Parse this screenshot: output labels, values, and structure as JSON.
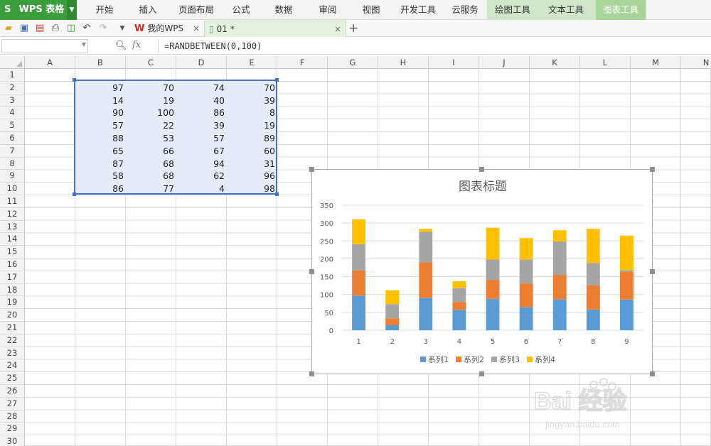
{
  "app": {
    "name": "WPS 表格",
    "logo_letter": "S"
  },
  "menu": {
    "items": [
      "开始",
      "插入",
      "页面布局",
      "公式",
      "数据",
      "审阅",
      "视图",
      "开发工具",
      "云服务",
      "绘图工具",
      "文本工具",
      "图表工具"
    ]
  },
  "tabs": [
    {
      "label": "我的WPS",
      "close": "×"
    },
    {
      "label": "01 *",
      "close": "×"
    }
  ],
  "add_tab": "+",
  "formula": {
    "fx": "fx",
    "value": "=RANDBETWEEN(0,100)"
  },
  "columns": [
    "A",
    "B",
    "C",
    "D",
    "E",
    "F",
    "G",
    "H",
    "I",
    "J",
    "K",
    "L",
    "M",
    "N"
  ],
  "rows": [
    "1",
    "2",
    "3",
    "4",
    "5",
    "6",
    "7",
    "8",
    "9",
    "10",
    "11",
    "12",
    "13",
    "14",
    "15",
    "16",
    "17",
    "18",
    "19",
    "20",
    "21",
    "22",
    "23",
    "24",
    "25",
    "26",
    "27",
    "28",
    "29",
    "30"
  ],
  "cells": [
    [
      97,
      70,
      74,
      70
    ],
    [
      14,
      19,
      40,
      39
    ],
    [
      90,
      100,
      86,
      8
    ],
    [
      57,
      22,
      39,
      19
    ],
    [
      88,
      53,
      57,
      89
    ],
    [
      65,
      66,
      67,
      60
    ],
    [
      87,
      68,
      94,
      31
    ],
    [
      58,
      68,
      62,
      96
    ],
    [
      86,
      77,
      4,
      98
    ]
  ],
  "colors": {
    "app_green": "#3a9e3a",
    "selection": "#4472c4",
    "series": [
      "#5b9bd5",
      "#ed7d31",
      "#a5a5a5",
      "#ffc000"
    ]
  },
  "chart_data": {
    "type": "bar",
    "stacked": true,
    "title": "图表标题",
    "categories": [
      "1",
      "2",
      "3",
      "4",
      "5",
      "6",
      "7",
      "8",
      "9"
    ],
    "series": [
      {
        "name": "系列1",
        "values": [
          97,
          14,
          90,
          57,
          88,
          65,
          87,
          58,
          86
        ]
      },
      {
        "name": "系列2",
        "values": [
          70,
          19,
          100,
          22,
          53,
          66,
          68,
          68,
          77
        ]
      },
      {
        "name": "系列3",
        "values": [
          74,
          40,
          86,
          39,
          57,
          67,
          94,
          62,
          4
        ]
      },
      {
        "name": "系列4",
        "values": [
          70,
          39,
          8,
          19,
          89,
          60,
          31,
          96,
          98
        ]
      }
    ],
    "yticks": [
      "0",
      "50",
      "100",
      "150",
      "200",
      "250",
      "300",
      "350"
    ],
    "ylim": [
      0,
      350
    ],
    "grid": true,
    "legend_position": "bottom"
  },
  "watermark": {
    "brand": "Bai 经验",
    "url": "jingyan.baidu.com"
  }
}
